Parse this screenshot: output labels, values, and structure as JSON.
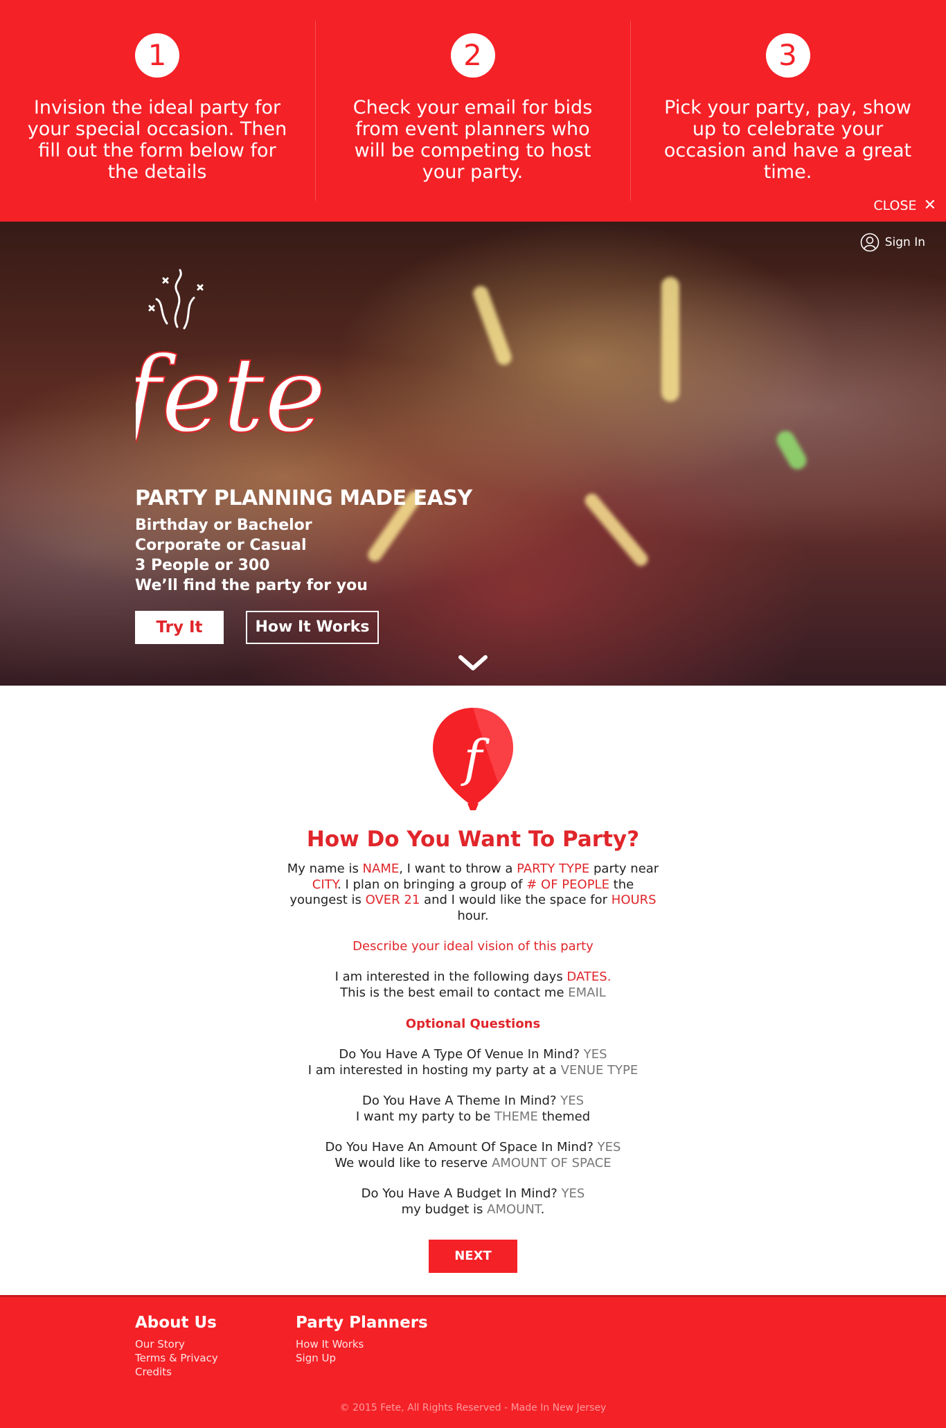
{
  "steps": [
    {
      "number": "1",
      "text": "Invision the ideal party for your special occasion. Then fill out the form below for the details"
    },
    {
      "number": "2",
      "text": "Check your email for bids from event planners who will be competing to host your party."
    },
    {
      "number": "3",
      "text": "Pick your party, pay, show up to celebrate your occasion and have a great time."
    }
  ],
  "banner": {
    "close_label": "CLOSE",
    "close_icon": "✕"
  },
  "hero": {
    "sign_in": "Sign In",
    "logo_text": "fete",
    "title": "PARTY PLANNING MADE EASY",
    "lines": [
      "Birthday or Bachelor",
      "Corporate or Casual",
      "3 People or 300",
      "We’ll find the party for you"
    ],
    "try_it": "Try It",
    "how_it_works": "How It Works"
  },
  "form": {
    "balloon_letter": "f",
    "title": "How Do You Want To Party?",
    "p1": {
      "t1": "My name is ",
      "name": "NAME",
      "t2": ", I want to throw a ",
      "party_type": "PARTY TYPE",
      "t3": " party near ",
      "city": "CITY",
      "t4": ". I plan on bringing a group of ",
      "people": "# OF PEOPLE",
      "t5": "  the youngest is ",
      "age": "OVER 21",
      "t6": " and I would like the space for ",
      "hours": "HOURS",
      "t7": " hour."
    },
    "describe": "Describe your ideal vision of this party",
    "dates_text": "I am interested in the following days ",
    "dates": "DATES",
    "period": ".",
    "email_text": "This is the best email to contact me ",
    "email": "EMAIL",
    "optional_title": "Optional Questions",
    "venue_q": "Do You Have A Type Of Venue In Mind? ",
    "venue_yes": "YES",
    "venue_text": "I am interested in hosting my party at a ",
    "venue_type": "VENUE TYPE",
    "theme_q": "Do You Have A Theme In Mind? ",
    "theme_yes": "YES",
    "theme_text1": "I want my party to be ",
    "theme": "THEME",
    "theme_text2": " themed",
    "space_q": "Do You Have An Amount Of Space In Mind? ",
    "space_yes": "YES",
    "space_text": "We would like to reserve ",
    "space": "AMOUNT OF SPACE",
    "budget_q": "Do You Have A Budget In Mind? ",
    "budget_yes": "YES",
    "budget_text": "my budget is ",
    "budget": "AMOUNT",
    "budget_end": ".",
    "next": "NEXT"
  },
  "footer": {
    "col1_title": "About Us",
    "col1_links": [
      "Our Story",
      "Terms & Privacy",
      "Credits"
    ],
    "col2_title": "Party Planners",
    "col2_links": [
      "How It Works",
      "Sign Up"
    ],
    "copyright": "© 2015 Fete, All Rights Reserved - Made In New Jersey"
  },
  "colors": {
    "brand_red": "#f42127",
    "accent_red": "#e0262b"
  }
}
